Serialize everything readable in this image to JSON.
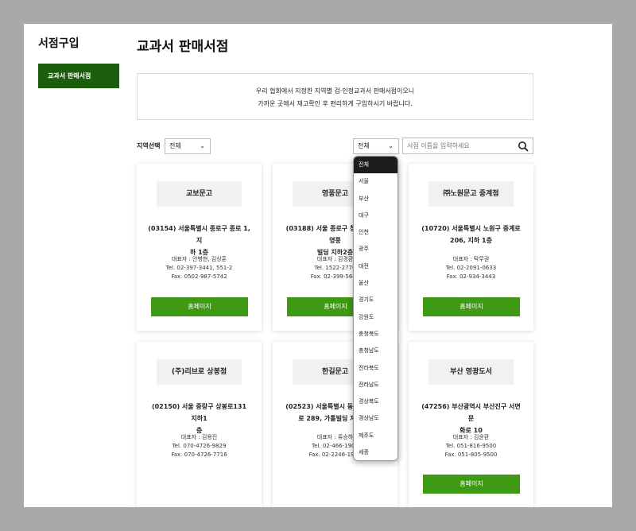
{
  "sidebar": {
    "title": "서점구입",
    "items": [
      {
        "label": "교과서 판매서점"
      }
    ]
  },
  "main": {
    "title": "교과서 판매서점",
    "notice_line1": "우리 협회에서 지정한 지역별 검·인정교과서 판매서점이오니",
    "notice_line2": "가까운 곳에서 재고확인 후 편리하게 구입하시기 바랍니다."
  },
  "filters": {
    "region_label": "지역선택",
    "region_select": "전체",
    "city_select": "전체",
    "search_placeholder": "서점 이름을 입력하세요"
  },
  "dropdown_options": [
    "전체",
    "서울",
    "부산",
    "대구",
    "인천",
    "광주",
    "대전",
    "울산",
    "경기도",
    "강원도",
    "충청북도",
    "충청남도",
    "전라북도",
    "전라남도",
    "경상북도",
    "경상남도",
    "제주도",
    "세종"
  ],
  "home_label": "홈페이지",
  "stores": [
    {
      "name": "교보문고",
      "addr1": "(03154) 서울특별시 종로구 종로 1, 지",
      "addr2": "하 1층",
      "rep": "대표자 : 안병현, 김상훈",
      "tel": "Tel. 02-397-3441, 551-2",
      "fax": "Fax. 0502-987-5742"
    },
    {
      "name": "영풍문고",
      "addr1": "(03188) 서울 종로구 청계천로 41 영풍",
      "addr2": "빌딩 지하2층",
      "rep": "대표자 : 김경환",
      "tel": "Tel. 1522-2776",
      "fax": "Fax. 02-399-5660"
    },
    {
      "name": "㈜노원문고 중계점",
      "addr1": "(10720) 서울특별시 노원구 중계로",
      "addr2": "206, 지하 1층",
      "rep": "대표자 : 탁무권",
      "tel": "Tel. 02-2091-0633",
      "fax": "Fax. 02-934-3443"
    },
    {
      "name": "(주)리브로 상봉점",
      "addr1": "(02150) 서울 중랑구 상봉로131 지하1",
      "addr2": "층",
      "rep": "대표자 : 김용진",
      "tel": "Tel. 070-4726-9829",
      "fax": "Fax. 070-4726-7716"
    },
    {
      "name": "한길문고",
      "addr1": "(02523) 서울특별시 동대문구 왕산",
      "addr2": "로 289, 가톨빌딩 지하1층",
      "rep": "대표자 : 류승하",
      "tel": "Tel. 02-466-1900",
      "fax": "Fax. 02-2246-1999"
    },
    {
      "name": "부산 영광도서",
      "addr1": "(47256) 부산광역시 부산진구 서면문",
      "addr2": "화로 10",
      "rep": "대표자 : 김윤환",
      "tel": "Tel. 051-816-9500",
      "fax": "Fax. 051-805-9500"
    }
  ],
  "colors": {
    "sidebar_active": "#1d5e0e",
    "button": "#3d9a12",
    "dropdown_active": "#1c1c1c"
  }
}
